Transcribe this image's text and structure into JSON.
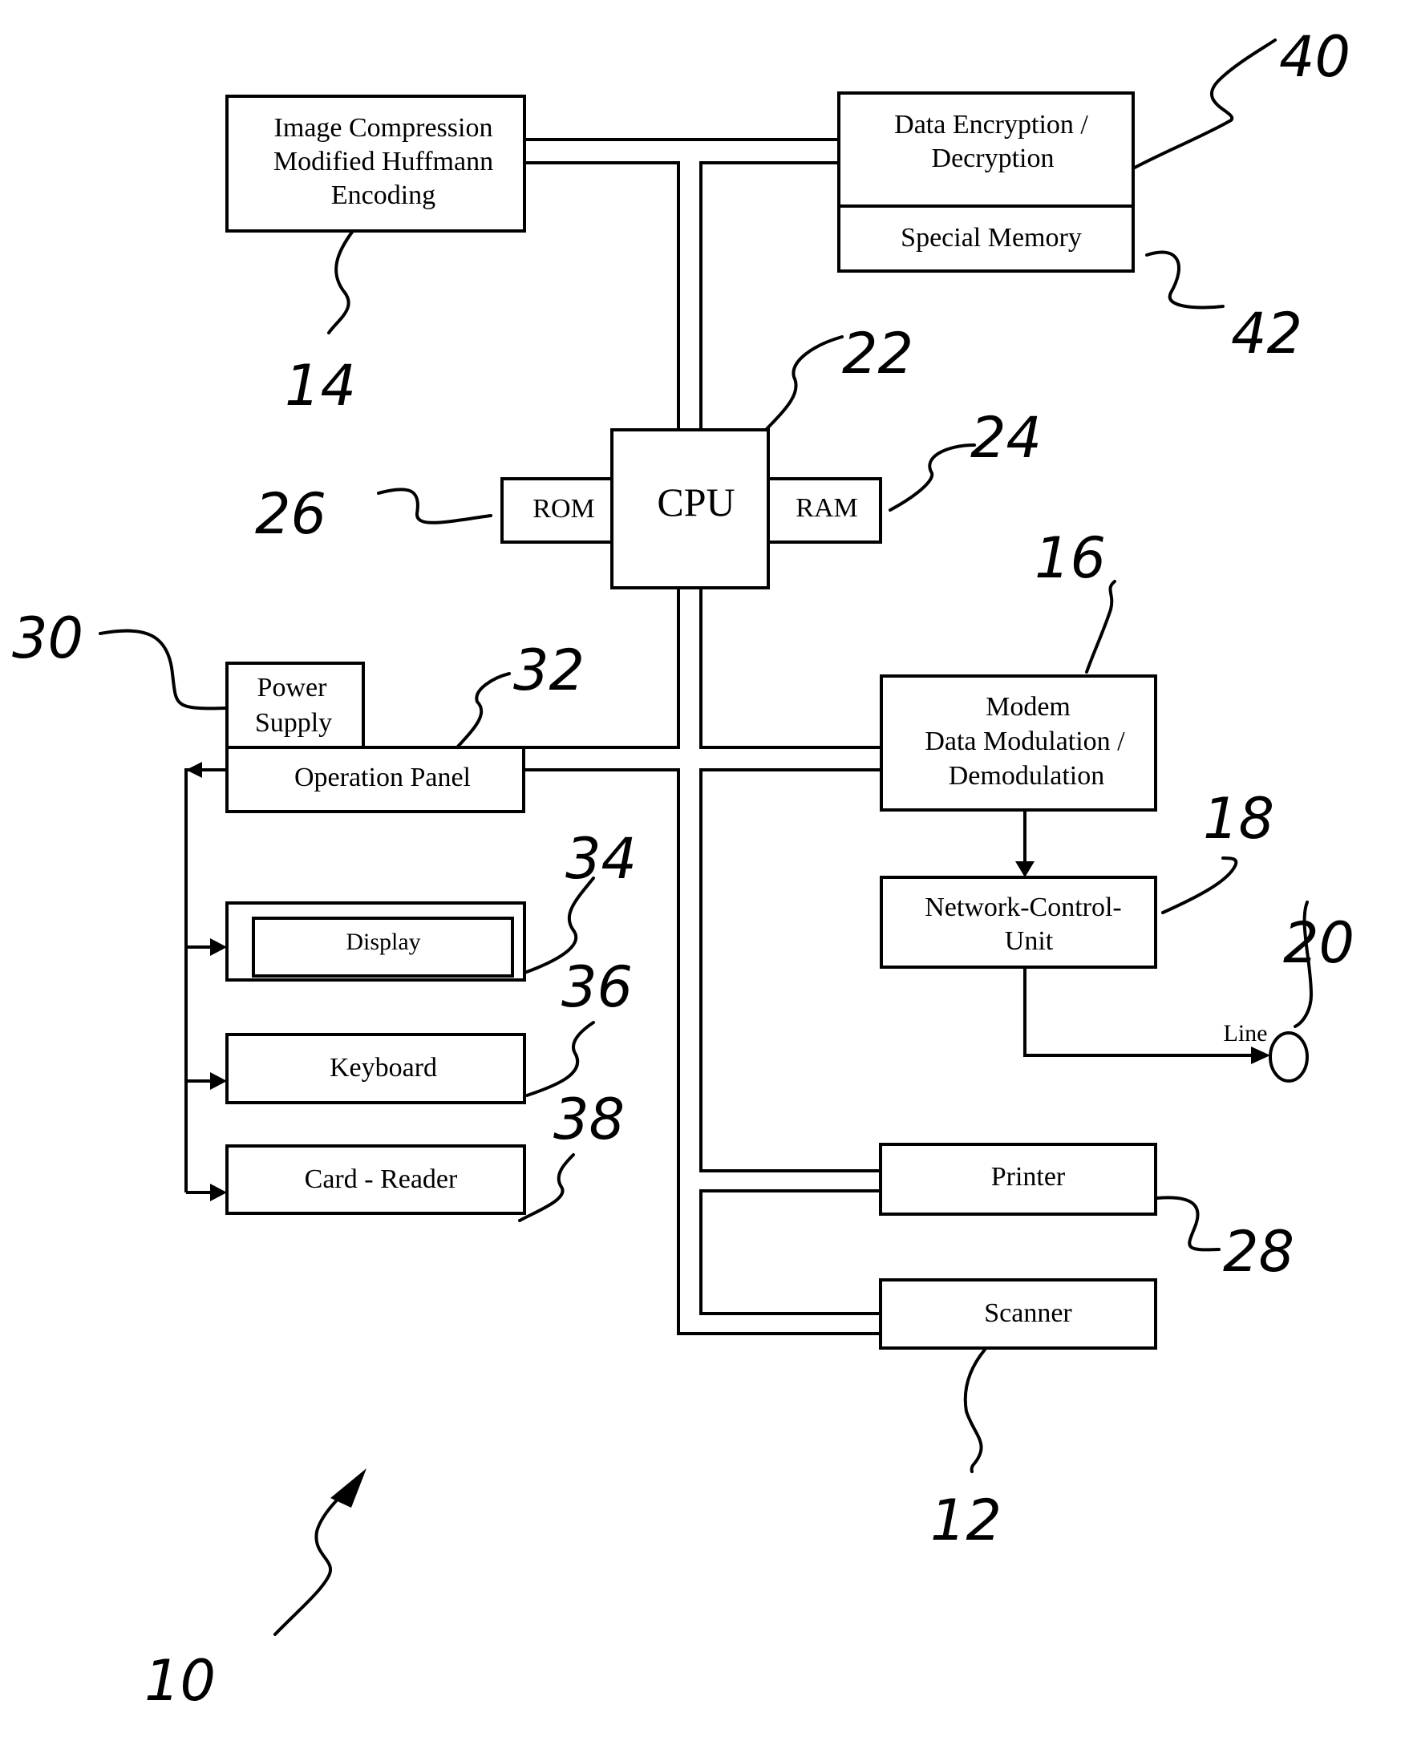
{
  "figure": {
    "type": "block-diagram",
    "reference_numeral": "10"
  },
  "blocks": {
    "image_compression": {
      "lines": [
        "Image Compression",
        "Modified Huffmann",
        "Encoding"
      ],
      "ref": "14"
    },
    "data_encryption": {
      "lines": [
        "Data Encryption /",
        "Decryption"
      ],
      "ref": "40"
    },
    "special_memory": {
      "lines": [
        "Special Memory"
      ],
      "ref": "42"
    },
    "cpu": {
      "lines": [
        "CPU"
      ],
      "ref": "22"
    },
    "rom": {
      "lines": [
        "ROM"
      ],
      "ref": "26"
    },
    "ram": {
      "lines": [
        "RAM"
      ],
      "ref": "24"
    },
    "power_supply": {
      "lines": [
        "Power",
        "Supply"
      ],
      "ref": "30"
    },
    "operation_panel": {
      "lines": [
        "Operation Panel"
      ],
      "ref": "32"
    },
    "modem": {
      "lines": [
        "Modem",
        "Data Modulation /",
        "Demodulation"
      ],
      "ref": "16"
    },
    "network_control_unit": {
      "lines": [
        "Network-Control-",
        "Unit"
      ],
      "ref": "18"
    },
    "display": {
      "lines": [
        "Display"
      ],
      "ref": "34"
    },
    "keyboard": {
      "lines": [
        "Keyboard"
      ],
      "ref": "36"
    },
    "card_reader": {
      "lines": [
        "Card - Reader"
      ],
      "ref": "38"
    },
    "printer": {
      "lines": [
        "Printer"
      ],
      "ref": "28"
    },
    "scanner": {
      "lines": [
        "Scanner"
      ],
      "ref": "12"
    },
    "line": {
      "lines": [
        "Line"
      ],
      "ref": "20"
    }
  },
  "connections": [
    {
      "from": "image_compression",
      "to": "bus",
      "style": "double"
    },
    {
      "from": "data_encryption",
      "to": "bus",
      "style": "double"
    },
    {
      "from": "cpu",
      "to": "bus",
      "style": "double"
    },
    {
      "from": "operation_panel",
      "to": "bus",
      "style": "double"
    },
    {
      "from": "modem",
      "to": "bus",
      "style": "double"
    },
    {
      "from": "printer",
      "to": "bus",
      "style": "double"
    },
    {
      "from": "scanner",
      "to": "bus",
      "style": "double"
    },
    {
      "from": "modem",
      "to": "network_control_unit",
      "style": "arrow"
    },
    {
      "from": "network_control_unit",
      "to": "line",
      "style": "arrow"
    },
    {
      "from": "operation_panel",
      "to": "display",
      "style": "arrow"
    },
    {
      "from": "operation_panel",
      "to": "keyboard",
      "style": "arrow"
    },
    {
      "from": "operation_panel",
      "to": "card_reader",
      "style": "arrow"
    }
  ]
}
